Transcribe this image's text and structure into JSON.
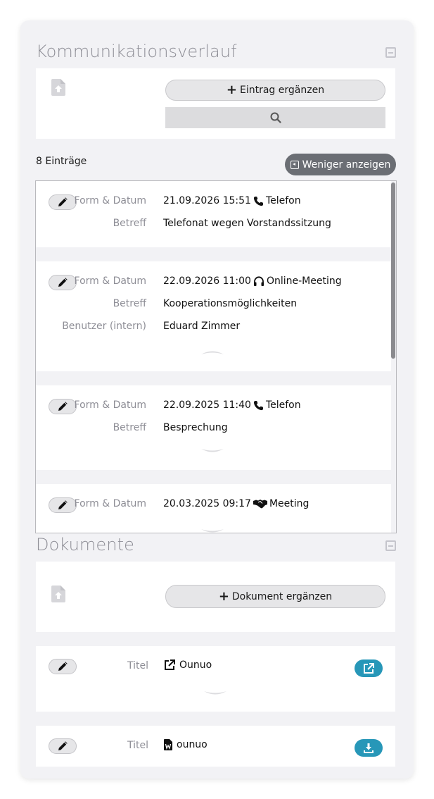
{
  "communication": {
    "title": "Kommunikationsverlauf",
    "add_entry_label": "Eintrag ergänzen",
    "count_label": "8 Einträge",
    "show_less_label": "Weniger anzeigen",
    "entries": [
      {
        "form_label": "Form & Datum",
        "datetime": "21.09.2026 15:51",
        "type_icon": "phone-icon",
        "type": "Telefon",
        "subject_label": "Betreff",
        "subject": "Telefonat wegen Vorstandssitzung"
      },
      {
        "form_label": "Form & Datum",
        "datetime": "22.09.2026 11:00",
        "type_icon": "headset-icon",
        "type": "Online-Meeting",
        "subject_label": "Betreff",
        "subject": "Kooperationsmöglichkeiten",
        "user_label": "Benutzer (intern)",
        "user": "Eduard Zimmer"
      },
      {
        "form_label": "Form & Datum",
        "datetime": "22.09.2025 11:40",
        "type_icon": "phone-icon",
        "type": "Telefon",
        "subject_label": "Betreff",
        "subject": "Besprechung"
      },
      {
        "form_label": "Form & Datum",
        "datetime": "20.03.2025 09:17",
        "type_icon": "handshake-icon",
        "type": "Meeting"
      }
    ]
  },
  "documents": {
    "title": "Dokumente",
    "add_document_label": "Dokument ergänzen",
    "items": [
      {
        "title_label": "Titel",
        "title_icon": "external-link-icon",
        "title": "Ounuo",
        "action_icon": "open-external-icon"
      },
      {
        "title_label": "Titel",
        "title_icon": "word-file-icon",
        "title": "ounuo",
        "action_icon": "download-icon"
      }
    ]
  },
  "colors": {
    "card_bg": "#f2f2f5",
    "accent": "#2797b8",
    "dark_button": "#6b6e74"
  }
}
